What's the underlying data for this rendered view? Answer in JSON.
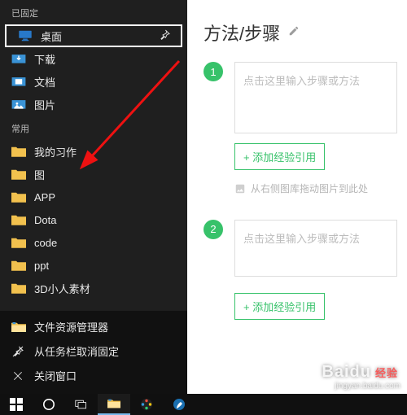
{
  "editor": {
    "title": "方法/步骤",
    "steps": [
      {
        "num": "1",
        "placeholder": "点击这里输入步骤或方法",
        "add_ref": "+ 添加经验引用",
        "drag_hint": "从右侧图库拖动图片到此处"
      },
      {
        "num": "2",
        "placeholder": "点击这里输入步骤或方法",
        "add_ref": "+ 添加经验引用"
      }
    ]
  },
  "jumplist": {
    "pinned_label": "已固定",
    "pinned": [
      {
        "label": "桌面",
        "icon": "monitor"
      }
    ],
    "items": [
      {
        "label": "下载",
        "color": "#4aa3df"
      },
      {
        "label": "文档",
        "color": "#4aa3df"
      },
      {
        "label": "图片",
        "color": "#4aa3df"
      }
    ],
    "frequent_label": "常用",
    "frequent": [
      {
        "label": "我的习作"
      },
      {
        "label": "图"
      },
      {
        "label": "APP"
      },
      {
        "label": "Dota"
      },
      {
        "label": "code"
      },
      {
        "label": "ppt"
      },
      {
        "label": "3D小人素材"
      }
    ],
    "bottom": {
      "explorer": "文件资源管理器",
      "unpin": "从任务栏取消固定",
      "close": "关闭窗口"
    }
  },
  "watermark": {
    "brand": "Baidu",
    "sub": "经验",
    "url": "jingyan.baidu.com"
  }
}
